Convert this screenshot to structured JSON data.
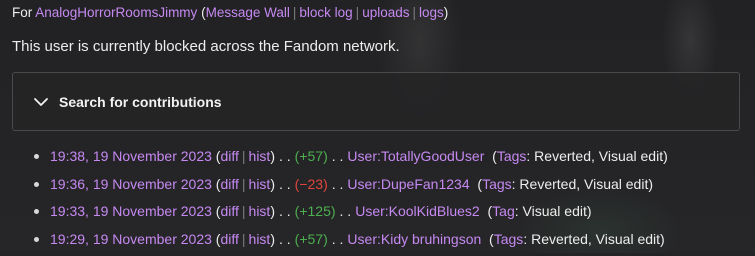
{
  "subtitle": {
    "prefix": "For",
    "username": "AnalogHorrorRoomsJimmy",
    "links": [
      "Message Wall",
      "block log",
      "uploads",
      "logs"
    ]
  },
  "status_text": "This user is currently blocked across the Fandom network.",
  "search": {
    "title": "Search for contributions",
    "icon": "chevron-down-icon"
  },
  "contributions": [
    {
      "time": "19:38, 19 November 2023",
      "diff": "diff",
      "hist": "hist",
      "change": "(+57)",
      "sign": "pos",
      "page": "User:TotallyGoodUser",
      "tag_label": "Tags",
      "tags": ": Reverted, Visual edit)"
    },
    {
      "time": "19:36, 19 November 2023",
      "diff": "diff",
      "hist": "hist",
      "change": "(−23)",
      "sign": "neg",
      "page": "User:DupeFan1234",
      "tag_label": "Tags",
      "tags": ": Reverted, Visual edit)"
    },
    {
      "time": "19:33, 19 November 2023",
      "diff": "diff",
      "hist": "hist",
      "change": "(+125)",
      "sign": "pos",
      "page": "User:KoolKidBlues2",
      "tag_label": "Tag",
      "tags": ": Visual edit)"
    },
    {
      "time": "19:29, 19 November 2023",
      "diff": "diff",
      "hist": "hist",
      "change": "(+57)",
      "sign": "pos",
      "page": "User:Kidy bruhingson",
      "tag_label": "Tags",
      "tags": ": Reverted, Visual edit)"
    }
  ],
  "colors": {
    "link": "#c689f2",
    "positive": "#4caf50",
    "negative": "#e0463e",
    "background": "#242426"
  }
}
